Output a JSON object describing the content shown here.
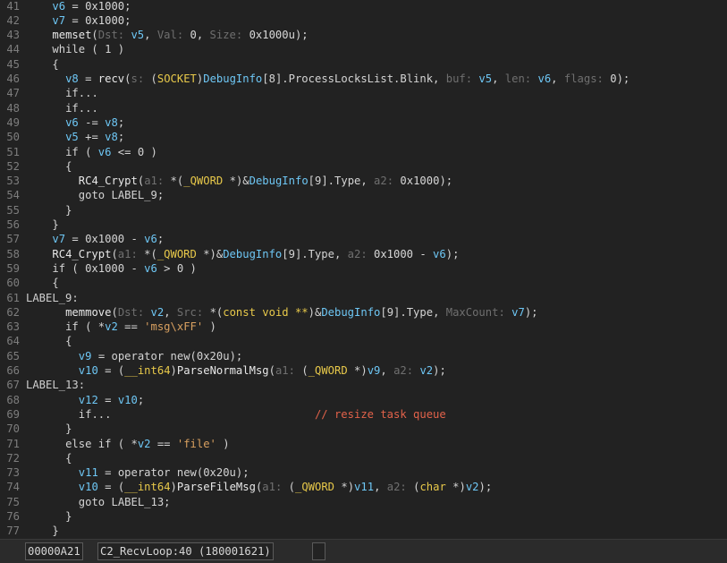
{
  "code_lines": [
    {
      "n": "41",
      "indent": 4,
      "tokens": [
        [
          "var",
          "v6"
        ],
        [
          "kw",
          " = "
        ],
        [
          "num",
          "0x1000"
        ],
        [
          "kw",
          ";"
        ]
      ]
    },
    {
      "n": "42",
      "indent": 4,
      "tokens": [
        [
          "var",
          "v7"
        ],
        [
          "kw",
          " = "
        ],
        [
          "num",
          "0x1000"
        ],
        [
          "kw",
          ";"
        ]
      ]
    },
    {
      "n": "43",
      "indent": 4,
      "tokens": [
        [
          "fn",
          "memset"
        ],
        [
          "kw",
          "("
        ],
        [
          "hint",
          "Dst: "
        ],
        [
          "var",
          "v5"
        ],
        [
          "kw",
          ", "
        ],
        [
          "hint",
          "Val: "
        ],
        [
          "num",
          "0"
        ],
        [
          "kw",
          ", "
        ],
        [
          "hint",
          "Size: "
        ],
        [
          "num",
          "0x1000u"
        ],
        [
          "kw",
          ");"
        ]
      ]
    },
    {
      "n": "44",
      "indent": 4,
      "tokens": [
        [
          "kw",
          "while ( 1 )"
        ]
      ]
    },
    {
      "n": "45",
      "indent": 4,
      "tokens": [
        [
          "kw",
          "{"
        ]
      ]
    },
    {
      "n": "46",
      "indent": 6,
      "tokens": [
        [
          "var",
          "v8"
        ],
        [
          "kw",
          " = "
        ],
        [
          "fn",
          "recv"
        ],
        [
          "kw",
          "("
        ],
        [
          "hint",
          "s: "
        ],
        [
          "kw",
          "("
        ],
        [
          "type",
          "SOCKET"
        ],
        [
          "kw",
          ")"
        ],
        [
          "glob",
          "DebugInfo"
        ],
        [
          "kw",
          "[8].ProcessLocksList.Blink, "
        ],
        [
          "hint",
          "buf: "
        ],
        [
          "var",
          "v5"
        ],
        [
          "kw",
          ", "
        ],
        [
          "hint",
          "len: "
        ],
        [
          "var",
          "v6"
        ],
        [
          "kw",
          ", "
        ],
        [
          "hint",
          "flags: "
        ],
        [
          "num",
          "0"
        ],
        [
          "kw",
          ");"
        ]
      ]
    },
    {
      "n": "47",
      "indent": 6,
      "tokens": [
        [
          "kw",
          "if..."
        ]
      ]
    },
    {
      "n": "48",
      "indent": 6,
      "tokens": [
        [
          "kw",
          "if..."
        ]
      ]
    },
    {
      "n": "49",
      "indent": 6,
      "tokens": [
        [
          "var",
          "v6"
        ],
        [
          "kw",
          " -= "
        ],
        [
          "var",
          "v8"
        ],
        [
          "kw",
          ";"
        ]
      ]
    },
    {
      "n": "50",
      "indent": 6,
      "tokens": [
        [
          "var",
          "v5"
        ],
        [
          "kw",
          " += "
        ],
        [
          "var",
          "v8"
        ],
        [
          "kw",
          ";"
        ]
      ]
    },
    {
      "n": "51",
      "indent": 6,
      "tokens": [
        [
          "kw",
          "if ( "
        ],
        [
          "var",
          "v6"
        ],
        [
          "kw",
          " <= 0 )"
        ]
      ]
    },
    {
      "n": "52",
      "indent": 6,
      "tokens": [
        [
          "kw",
          "{"
        ]
      ]
    },
    {
      "n": "53",
      "indent": 8,
      "tokens": [
        [
          "fn",
          "RC4_Crypt"
        ],
        [
          "kw",
          "("
        ],
        [
          "hint",
          "a1: "
        ],
        [
          "kw",
          "*("
        ],
        [
          "type",
          "_QWORD"
        ],
        [
          "kw",
          " *)&"
        ],
        [
          "glob",
          "DebugInfo"
        ],
        [
          "kw",
          "[9].Type, "
        ],
        [
          "hint",
          "a2: "
        ],
        [
          "num",
          "0x1000"
        ],
        [
          "kw",
          ");"
        ]
      ]
    },
    {
      "n": "54",
      "indent": 8,
      "tokens": [
        [
          "kw",
          "goto LABEL_9;"
        ]
      ]
    },
    {
      "n": "55",
      "indent": 6,
      "tokens": [
        [
          "kw",
          "}"
        ]
      ]
    },
    {
      "n": "56",
      "indent": 4,
      "tokens": [
        [
          "kw",
          "}"
        ]
      ]
    },
    {
      "n": "57",
      "indent": 4,
      "tokens": [
        [
          "var",
          "v7"
        ],
        [
          "kw",
          " = 0x1000 - "
        ],
        [
          "var",
          "v6"
        ],
        [
          "kw",
          ";"
        ]
      ]
    },
    {
      "n": "58",
      "indent": 4,
      "tokens": [
        [
          "fn",
          "RC4_Crypt"
        ],
        [
          "kw",
          "("
        ],
        [
          "hint",
          "a1: "
        ],
        [
          "kw",
          "*("
        ],
        [
          "type",
          "_QWORD"
        ],
        [
          "kw",
          " *)&"
        ],
        [
          "glob",
          "DebugInfo"
        ],
        [
          "kw",
          "[9].Type, "
        ],
        [
          "hint",
          "a2: "
        ],
        [
          "num",
          "0x1000 - "
        ],
        [
          "var",
          "v6"
        ],
        [
          "kw",
          ");"
        ]
      ]
    },
    {
      "n": "59",
      "indent": 4,
      "tokens": [
        [
          "kw",
          "if ( 0x1000 - "
        ],
        [
          "var",
          "v6"
        ],
        [
          "kw",
          " > 0 )"
        ]
      ]
    },
    {
      "n": "60",
      "indent": 4,
      "tokens": [
        [
          "kw",
          "{"
        ]
      ]
    },
    {
      "n": "61",
      "indent": 0,
      "tokens": [
        [
          "lbl",
          "LABEL_9:"
        ]
      ]
    },
    {
      "n": "62",
      "indent": 6,
      "tokens": [
        [
          "fn",
          "memmove"
        ],
        [
          "kw",
          "("
        ],
        [
          "hint",
          "Dst: "
        ],
        [
          "var",
          "v2"
        ],
        [
          "kw",
          ", "
        ],
        [
          "hint",
          "Src: "
        ],
        [
          "kw",
          "*("
        ],
        [
          "type",
          "const void **"
        ],
        [
          "kw",
          ")&"
        ],
        [
          "glob",
          "DebugInfo"
        ],
        [
          "kw",
          "[9].Type, "
        ],
        [
          "hint",
          "MaxCount: "
        ],
        [
          "var",
          "v7"
        ],
        [
          "kw",
          ");"
        ]
      ]
    },
    {
      "n": "63",
      "indent": 6,
      "tokens": [
        [
          "kw",
          "if ( *"
        ],
        [
          "var",
          "v2"
        ],
        [
          "kw",
          " == "
        ],
        [
          "str",
          "'msg\\xFF'"
        ],
        [
          "kw",
          " )"
        ]
      ]
    },
    {
      "n": "64",
      "indent": 6,
      "tokens": [
        [
          "kw",
          "{"
        ]
      ]
    },
    {
      "n": "65",
      "indent": 8,
      "tokens": [
        [
          "var",
          "v9"
        ],
        [
          "kw",
          " = operator new(0x20u);"
        ]
      ]
    },
    {
      "n": "66",
      "indent": 8,
      "tokens": [
        [
          "var",
          "v10"
        ],
        [
          "kw",
          " = ("
        ],
        [
          "type",
          "__int64"
        ],
        [
          "kw",
          ")"
        ],
        [
          "fn",
          "ParseNormalMsg"
        ],
        [
          "kw",
          "("
        ],
        [
          "hint",
          "a1: "
        ],
        [
          "kw",
          "("
        ],
        [
          "type",
          "_QWORD"
        ],
        [
          "kw",
          " *)"
        ],
        [
          "var",
          "v9"
        ],
        [
          "kw",
          ", "
        ],
        [
          "hint",
          "a2: "
        ],
        [
          "var",
          "v2"
        ],
        [
          "kw",
          ");"
        ]
      ]
    },
    {
      "n": "67",
      "indent": 0,
      "tokens": [
        [
          "lbl",
          "LABEL_13:"
        ]
      ]
    },
    {
      "n": "68",
      "indent": 8,
      "tokens": [
        [
          "var",
          "v12"
        ],
        [
          "kw",
          " = "
        ],
        [
          "var",
          "v10"
        ],
        [
          "kw",
          ";"
        ]
      ]
    },
    {
      "n": "69",
      "indent": 8,
      "tokens": [
        [
          "kw",
          "if...                               "
        ],
        [
          "cmt",
          "// resize task queue"
        ]
      ]
    },
    {
      "n": "70",
      "indent": 6,
      "tokens": [
        [
          "kw",
          "}"
        ]
      ]
    },
    {
      "n": "71",
      "indent": 6,
      "tokens": [
        [
          "kw",
          "else if ( *"
        ],
        [
          "var",
          "v2"
        ],
        [
          "kw",
          " == "
        ],
        [
          "str",
          "'file'"
        ],
        [
          "kw",
          " )"
        ]
      ]
    },
    {
      "n": "72",
      "indent": 6,
      "tokens": [
        [
          "kw",
          "{"
        ]
      ]
    },
    {
      "n": "73",
      "indent": 8,
      "tokens": [
        [
          "var",
          "v11"
        ],
        [
          "kw",
          " = operator new(0x20u);"
        ]
      ]
    },
    {
      "n": "74",
      "indent": 8,
      "tokens": [
        [
          "var",
          "v10"
        ],
        [
          "kw",
          " = ("
        ],
        [
          "type",
          "__int64"
        ],
        [
          "kw",
          ")"
        ],
        [
          "fn",
          "ParseFileMsg"
        ],
        [
          "kw",
          "("
        ],
        [
          "hint",
          "a1: "
        ],
        [
          "kw",
          "("
        ],
        [
          "type",
          "_QWORD"
        ],
        [
          "kw",
          " *)"
        ],
        [
          "var",
          "v11"
        ],
        [
          "kw",
          ", "
        ],
        [
          "hint",
          "a2: "
        ],
        [
          "kw",
          "("
        ],
        [
          "type",
          "char"
        ],
        [
          "kw",
          " *)"
        ],
        [
          "var",
          "v2"
        ],
        [
          "kw",
          ");"
        ]
      ]
    },
    {
      "n": "75",
      "indent": 8,
      "tokens": [
        [
          "kw",
          "goto LABEL_13;"
        ]
      ]
    },
    {
      "n": "76",
      "indent": 6,
      "tokens": [
        [
          "kw",
          "}"
        ]
      ]
    },
    {
      "n": "77",
      "indent": 4,
      "tokens": [
        [
          "kw",
          "}"
        ]
      ]
    }
  ],
  "statusbar": {
    "address": "00000A21",
    "location": "C2_RecvLoop:40 (180001621)",
    "extra": " "
  },
  "colors": {
    "background": "#222222",
    "variable": "#6ec7f5",
    "type": "#e8c94a",
    "string": "#d8a060",
    "comment": "#e2624a",
    "hint": "#6f6f6f"
  }
}
